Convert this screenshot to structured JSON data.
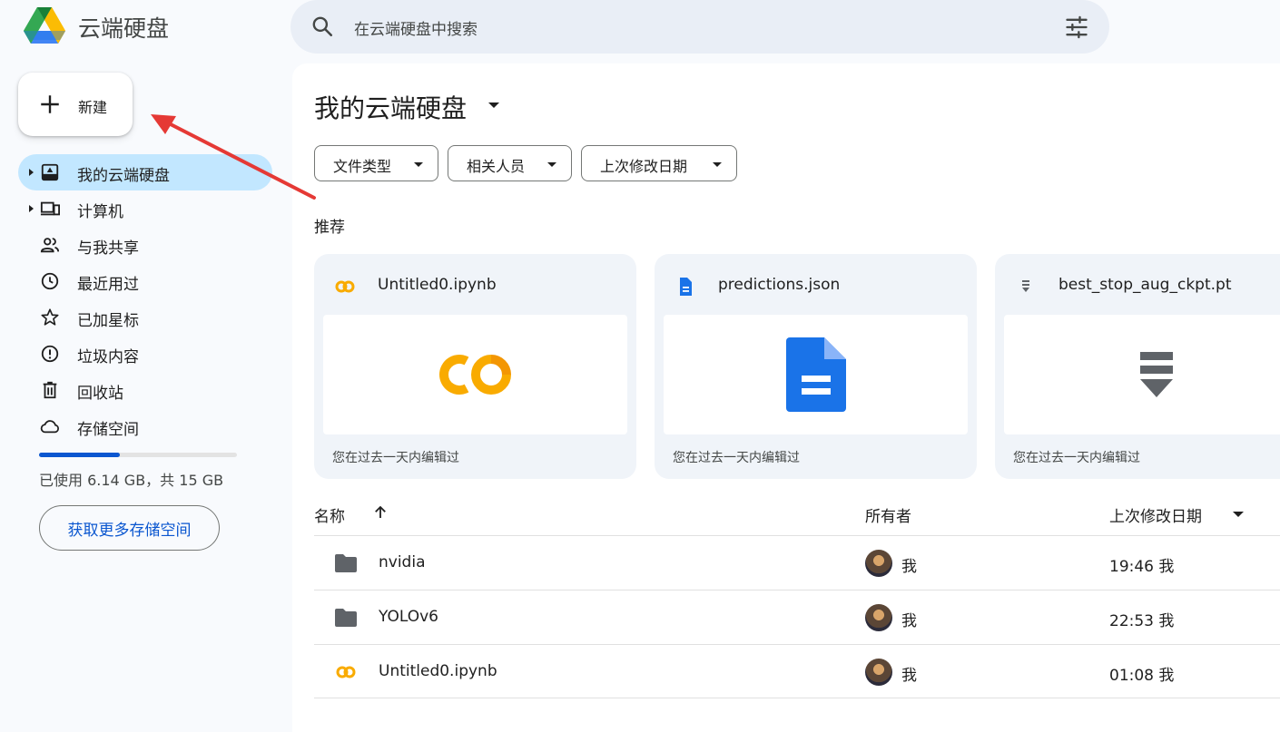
{
  "app": {
    "title": "云端硬盘"
  },
  "search": {
    "placeholder": "在云端硬盘中搜索"
  },
  "sidebar": {
    "new_label": "新建",
    "items": [
      {
        "label": "我的云端硬盘",
        "icon": "my-drive-icon",
        "active": true,
        "caret": true
      },
      {
        "label": "计算机",
        "icon": "computers-icon",
        "active": false,
        "caret": true
      },
      {
        "label": "与我共享",
        "icon": "shared-icon",
        "active": false,
        "caret": false
      },
      {
        "label": "最近用过",
        "icon": "clock-icon",
        "active": false,
        "caret": false
      },
      {
        "label": "已加星标",
        "icon": "star-icon",
        "active": false,
        "caret": false
      },
      {
        "label": "垃圾内容",
        "icon": "spam-icon",
        "active": false,
        "caret": false
      },
      {
        "label": "回收站",
        "icon": "trash-icon",
        "active": false,
        "caret": false
      },
      {
        "label": "存储空间",
        "icon": "cloud-icon",
        "active": false,
        "caret": false
      }
    ],
    "storage": {
      "used_fraction": 0.41,
      "text": "已使用 6.14 GB，共 15 GB"
    },
    "more_storage_label": "获取更多存储空间"
  },
  "main": {
    "title": "我的云端硬盘",
    "filters": [
      "文件类型",
      "相关人员",
      "上次修改日期"
    ],
    "suggested_label": "推荐",
    "cards": [
      {
        "name": "Untitled0.ipynb",
        "icon": "colab-icon",
        "subtitle": "您在过去一天内编辑过"
      },
      {
        "name": "predictions.json",
        "icon": "doc-icon",
        "subtitle": "您在过去一天内编辑过"
      },
      {
        "name": "best_stop_aug_ckpt.pt",
        "icon": "binary-file-icon",
        "subtitle": "您在过去一天内编辑过"
      }
    ],
    "list": {
      "headers": {
        "name": "名称",
        "owner": "所有者",
        "modified": "上次修改日期"
      },
      "rows": [
        {
          "name": "nvidia",
          "icon": "folder-icon",
          "owner": "我",
          "modified": "19:46 我"
        },
        {
          "name": "YOLOv6",
          "icon": "folder-icon",
          "owner": "我",
          "modified": "22:53 我"
        },
        {
          "name": "Untitled0.ipynb",
          "icon": "colab-icon",
          "owner": "我",
          "modified": "01:08 我"
        }
      ]
    }
  },
  "colors": {
    "accent": "#0b57d0",
    "active_nav": "#c2e7ff",
    "annotation": "#e53935",
    "colab": "#f9ab00"
  }
}
